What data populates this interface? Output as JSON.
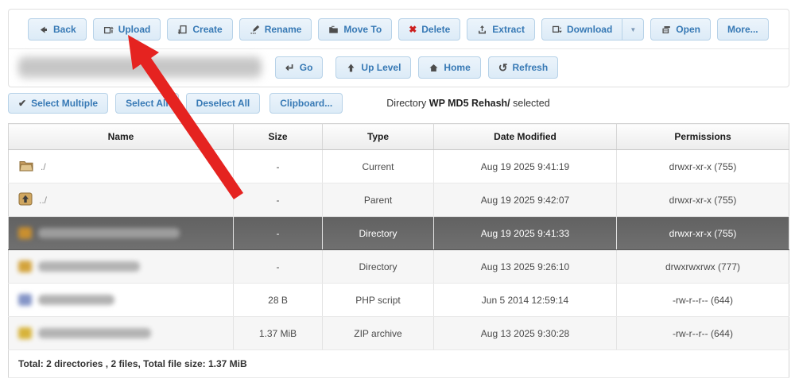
{
  "toolbar": {
    "back": "Back",
    "upload": "Upload",
    "create": "Create",
    "rename": "Rename",
    "move_to": "Move To",
    "delete": "Delete",
    "extract": "Extract",
    "download": "Download",
    "open": "Open",
    "more": "More..."
  },
  "navbar": {
    "go": "Go",
    "up_level": "Up Level",
    "home": "Home",
    "refresh": "Refresh"
  },
  "selectbar": {
    "select_multiple": "Select Multiple",
    "select_all": "Select All",
    "deselect_all": "Deselect All",
    "clipboard": "Clipboard...",
    "status_prefix": "Directory",
    "status_directory": "WP MD5 Rehash/",
    "status_suffix": "selected"
  },
  "icons": {
    "delete_x": "✖",
    "caret": "▼",
    "go_return": "↵",
    "refresh_arrow": "↺",
    "check": "✔"
  },
  "table": {
    "columns": [
      "Name",
      "Size",
      "Type",
      "Date Modified",
      "Permissions"
    ],
    "rows": [
      {
        "name": "./",
        "size": "-",
        "type": "Current",
        "date_modified": "Aug 19 2025 9:41:19",
        "permissions": "drwxr-xr-x (755)",
        "icon": "folder-current",
        "selected": false,
        "redacted": false
      },
      {
        "name": "../",
        "size": "-",
        "type": "Parent",
        "date_modified": "Aug 19 2025 9:42:07",
        "permissions": "drwxr-xr-x (755)",
        "icon": "folder-parent",
        "selected": false,
        "redacted": false
      },
      {
        "size": "-",
        "type": "Directory",
        "date_modified": "Aug 19 2025 9:41:33",
        "permissions": "drwxr-xr-x (755)",
        "icon": "folder",
        "selected": true,
        "redacted": true
      },
      {
        "size": "-",
        "type": "Directory",
        "date_modified": "Aug 13 2025 9:26:10",
        "permissions": "drwxrwxrwx (777)",
        "icon": "folder",
        "selected": false,
        "redacted": true
      },
      {
        "size": "28 B",
        "type": "PHP script",
        "date_modified": "Jun 5 2014 12:59:14",
        "permissions": "-rw-r--r-- (644)",
        "icon": "php-file",
        "selected": false,
        "redacted": true
      },
      {
        "size": "1.37 MiB",
        "type": "ZIP archive",
        "date_modified": "Aug 13 2025 9:30:28",
        "permissions": "-rw-r--r-- (644)",
        "icon": "zip-file",
        "selected": false,
        "redacted": true
      }
    ]
  },
  "footer": {
    "total": "Total: 2 directories , 2 files, Total file size: 1.37 MiB"
  },
  "colors": {
    "button_text": "#3779b5",
    "button_bg": "#e2eef9",
    "button_border": "#b7d2e8",
    "selected_row_bg": "#6b6b6b",
    "delete_red": "#cc1f1f",
    "arrow_red": "#e52320"
  }
}
